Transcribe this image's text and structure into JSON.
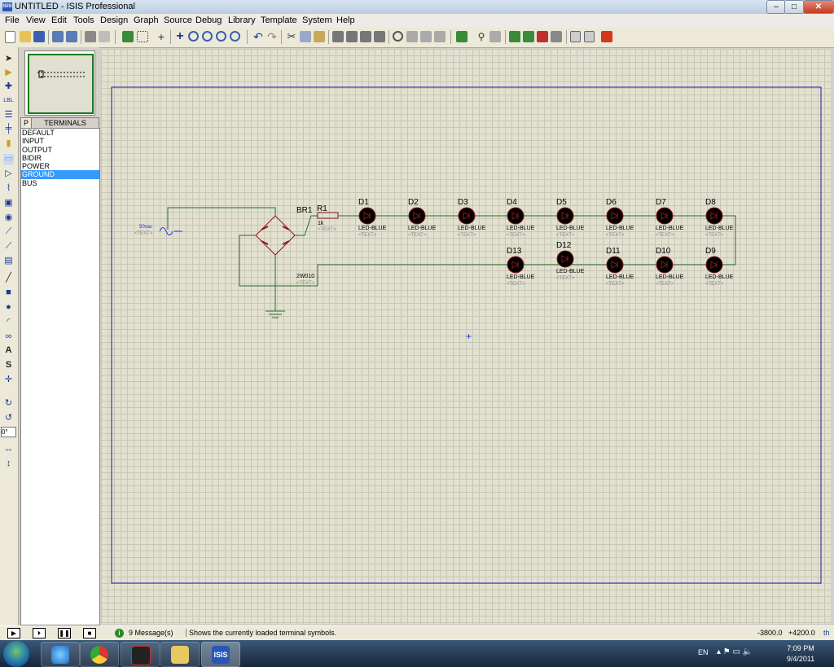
{
  "window": {
    "title": "UNTITLED - ISIS Professional",
    "icon_label": "ISIS",
    "minimize_label": "–",
    "maximize_label": "□",
    "close_label": "✕"
  },
  "menu": [
    "File",
    "View",
    "Edit",
    "Tools",
    "Design",
    "Graph",
    "Source",
    "Debug",
    "Library",
    "Template",
    "System",
    "Help"
  ],
  "toolbar_icons": [
    "new-icon",
    "open-icon",
    "save-icon",
    "import-icon",
    "export-icon",
    "print-icon",
    "print-area-icon",
    "refresh-icon",
    "grid-icon",
    "origin-icon",
    "pan-icon",
    "zoom-in-icon",
    "zoom-out-icon",
    "zoom-all-icon",
    "zoom-area-icon",
    "undo-icon",
    "redo-icon",
    "cut-icon",
    "copy-icon",
    "paste-icon",
    "copy-block-icon",
    "move-block-icon",
    "rotate-block-icon",
    "delete-block-icon",
    "pick-device-icon",
    "make-device-icon",
    "package-tool-icon",
    "decompose-icon",
    "wire-autorouter-icon",
    "search-tag-icon",
    "property-tool-icon",
    "new-sheet-icon",
    "remove-sheet-icon",
    "exit-to-parent-icon",
    "bill-of-materials-icon",
    "electrical-check-icon",
    "netlist-to-ares-icon"
  ],
  "left_panel": {
    "p_label": "P",
    "list_title": "TERMINALS",
    "terminals": [
      "DEFAULT",
      "INPUT",
      "OUTPUT",
      "BIDIR",
      "POWER",
      "GROUND",
      "BUS"
    ],
    "selected": "GROUND",
    "rotation_value": "0°"
  },
  "schematic": {
    "source_label": "50vac",
    "text_placeholder": "<TEXT>",
    "bridge_label": "BR1",
    "bridge_part": "2W010",
    "resistor_label": "R1",
    "resistor_value": "1k",
    "top_row": [
      "D1",
      "D2",
      "D3",
      "D4",
      "D5",
      "D6",
      "D7",
      "D8"
    ],
    "bottom_row": [
      "D13",
      "D12",
      "D11",
      "D10",
      "D9"
    ],
    "led_type": "LED-BLUE"
  },
  "status": {
    "message_count": "9 Message(s)",
    "info_icon": "i",
    "status_text": "Shows the currently loaded terminal symbols.",
    "coord_x": "-3800.0",
    "coord_y": "+4200.0",
    "coord_unit": "th"
  },
  "tray": {
    "language": "EN",
    "time": "7:09 PM",
    "date": "9/4/2011"
  },
  "colors": {
    "wire": "#2a6b2a",
    "component": "#8b1a1a",
    "led_body": "#000000",
    "sheet_border": "#1a1a9a",
    "selected_highlight": "#3399ff"
  }
}
